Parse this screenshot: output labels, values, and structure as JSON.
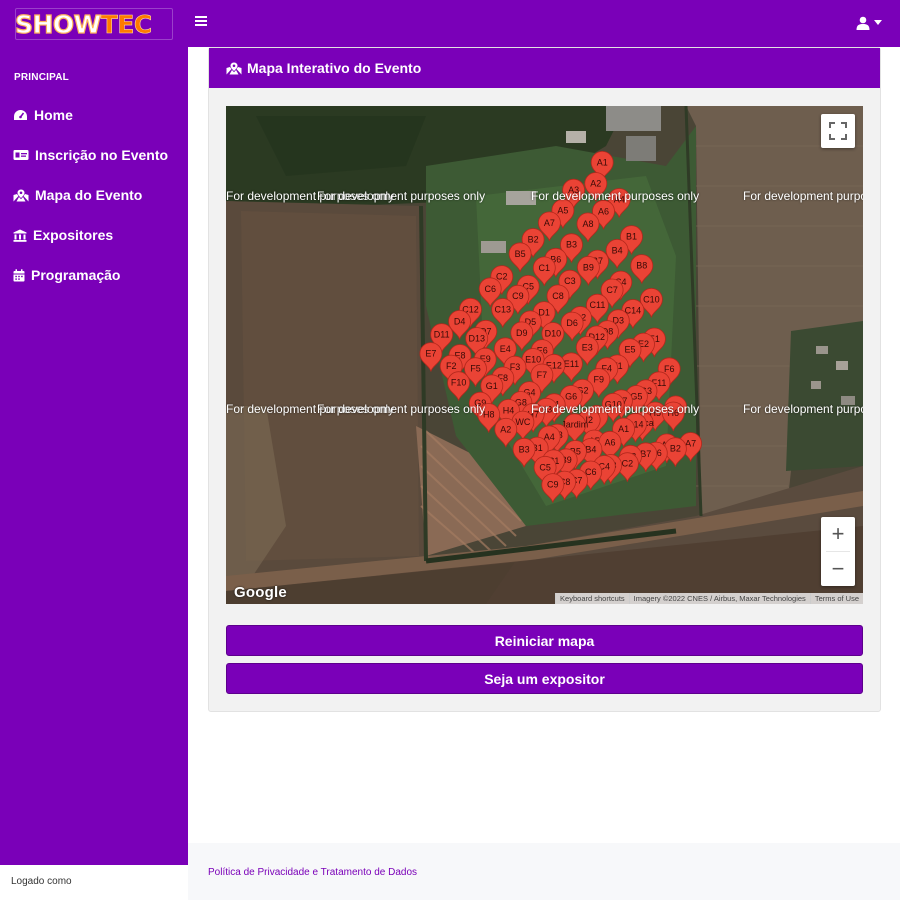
{
  "brand": {
    "show": "SHOW",
    "tec": "TEC"
  },
  "header": {
    "menu_icon": "bars-icon",
    "user_icon": "user-icon"
  },
  "sidebar": {
    "section_heading": "PRINCIPAL",
    "items": [
      {
        "label": "Home",
        "icon": "tachometer-icon"
      },
      {
        "label": "Inscrição no Evento",
        "icon": "id-card-icon"
      },
      {
        "label": "Mapa do Evento",
        "icon": "map-marked-icon"
      },
      {
        "label": "Expositores",
        "icon": "landmark-icon"
      },
      {
        "label": "Programação",
        "icon": "calendar-icon"
      }
    ],
    "footer_text": "Logado como"
  },
  "card": {
    "title": "Mapa Interativo do Evento",
    "icon": "map-marked-icon"
  },
  "map": {
    "watermark": "For development purposes only",
    "google_label": "Google",
    "attribution": [
      "Keyboard shortcuts",
      "Imagery ©2022 CNES / Airbus, Maxar Technologies",
      "Terms of Use"
    ],
    "zoom_in": "+",
    "zoom_out": "−",
    "markers": [
      "A1",
      "A2",
      "A3",
      "A4",
      "A5",
      "A6",
      "A7",
      "A8",
      "B1",
      "B2",
      "B3",
      "B4",
      "B5",
      "B6",
      "B7",
      "B8",
      "B9",
      "C1",
      "C2",
      "C3",
      "C4",
      "C5",
      "C6",
      "C7",
      "C8",
      "C9",
      "C10",
      "C11",
      "C12",
      "C13",
      "C14",
      "D1",
      "D2",
      "D3",
      "D4",
      "D5",
      "D6",
      "D7",
      "D8",
      "D9",
      "D10",
      "D11",
      "D12",
      "D13",
      "E1",
      "E2",
      "E3",
      "E4",
      "E5",
      "E6",
      "E7",
      "E8",
      "E9",
      "E10",
      "E11",
      "E12",
      "F1",
      "F2",
      "F3",
      "F4",
      "F5",
      "F6",
      "F7",
      "F8",
      "F9",
      "F10",
      "F11",
      "G1",
      "G2",
      "G3",
      "G4",
      "G5",
      "G6",
      "G7",
      "G8",
      "G9",
      "G10",
      "H1",
      "H2",
      "H3",
      "H4",
      "H5",
      "H6",
      "H7",
      "H8",
      "I1",
      "I2",
      "WC",
      "Tráca",
      "B14",
      "Jardim"
    ]
  },
  "buttons": {
    "reset": "Reiniciar mapa",
    "exhibitor": "Seja um expositor"
  },
  "footer": {
    "privacy_link": "Política de Privacidade e Tratamento de Dados"
  },
  "colors": {
    "primary": "#7a00b8",
    "marker": "#ea4335",
    "accent": "#ff7a00"
  }
}
